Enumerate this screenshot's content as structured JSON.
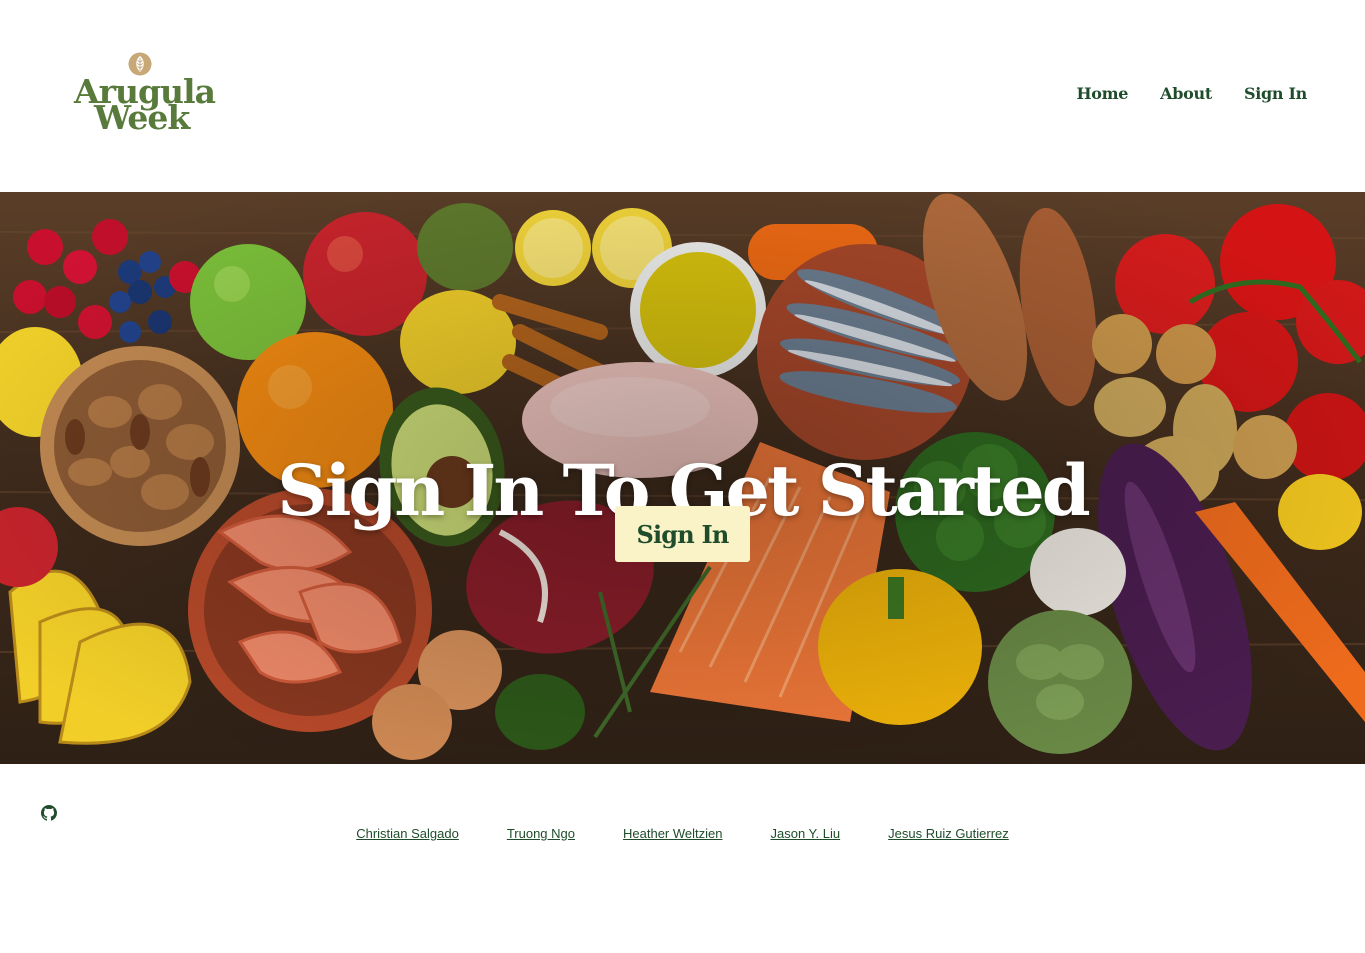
{
  "brand": {
    "line1": "Arugula",
    "line2": "Week",
    "logo_icon": "leaf-icon",
    "color": "#587a3a",
    "leaf_color": "#c9a878"
  },
  "nav": {
    "items": [
      {
        "label": "Home"
      },
      {
        "label": "About"
      },
      {
        "label": "Sign In"
      }
    ],
    "color": "#1f4d2b"
  },
  "hero": {
    "title": "Sign In To Get Started",
    "button_label": "Sign In",
    "button_color": "#fbf3c8"
  },
  "footer": {
    "github_icon": "github-icon",
    "credits": [
      "Christian Salgado",
      "Truong Ngo",
      "Heather Weltzien",
      "Jason Y. Liu",
      "Jesus Ruiz Gutierrez"
    ]
  }
}
